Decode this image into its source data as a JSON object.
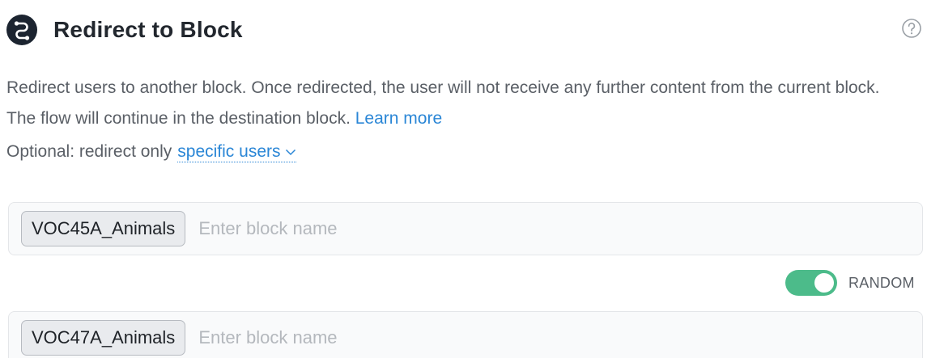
{
  "header": {
    "title": "Redirect to Block",
    "icon": "redirect-block-icon",
    "help_icon": "help-circle-icon",
    "icon_color": "#1c2430"
  },
  "description": {
    "text": "Redirect users to another block. Once redirected, the user will not receive any further content from the current block. The flow will continue in the destination block.",
    "learn_more": "Learn more",
    "optional_prefix": "Optional: redirect only",
    "specific_users": "specific users"
  },
  "redirects": [
    {
      "chip": "VOC45A_Animals",
      "placeholder": "Enter block name",
      "value": ""
    },
    {
      "chip": "VOC47A_Animals",
      "placeholder": "Enter block name",
      "value": ""
    }
  ],
  "random_toggle": {
    "label": "RANDOM",
    "state": "on",
    "color": "#4cbb8a"
  },
  "colors": {
    "link": "#2a86d6",
    "text_secondary": "#5a5f66"
  }
}
